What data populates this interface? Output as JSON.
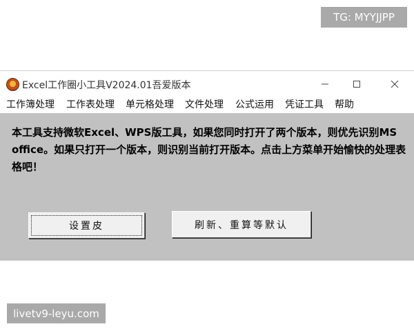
{
  "overlay": {
    "tg_label": "TG: MYYJJPP",
    "watermark": "livetv9-leyu.com"
  },
  "window": {
    "title": "Excel工作圈小工具V2024.01吾爱版本",
    "icon": "app-logo-icon",
    "controls": {
      "minimize_icon": "minimize-icon",
      "maximize_icon": "maximize-icon",
      "close_icon": "close-icon"
    }
  },
  "menu": {
    "items": [
      {
        "label": "工作簿处理"
      },
      {
        "label": "工作表处理"
      },
      {
        "label": "单元格处理"
      },
      {
        "label": "文件处理"
      },
      {
        "label": "公式运用"
      },
      {
        "label": "凭证工具"
      },
      {
        "label": "帮助"
      }
    ]
  },
  "main": {
    "notice": "本工具支持微软Excel、WPS版工具，如果您同时打开了两个版本，则优先识别MS office。如果只打开一个版本，则识别当前打开版本。点击上方菜单开始愉快的处理表格吧！",
    "skin_button": "设置皮",
    "refresh_button": "刷新、重算等默认"
  },
  "colors": {
    "client_bg": "#c1c1c1",
    "button_face": "#f0f0f0",
    "overlay_badge": "#a9a9a9"
  }
}
